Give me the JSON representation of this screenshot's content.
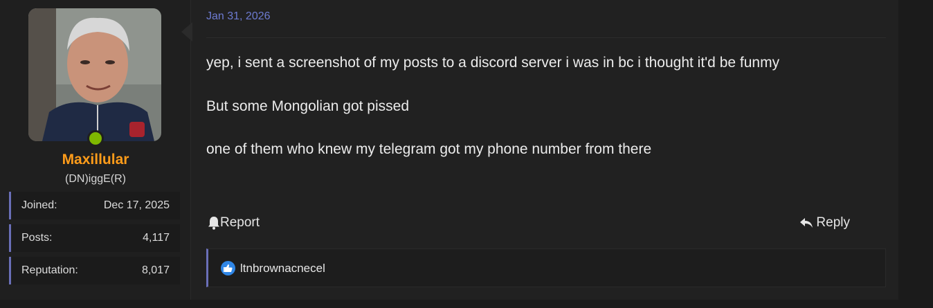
{
  "user": {
    "username": "Maxillular",
    "title": "(DN)iggE(R)",
    "online_status_color": "#7fb800",
    "username_color": "#ff9c1a",
    "stats": [
      {
        "label": "Joined:",
        "value": "Dec 17, 2025"
      },
      {
        "label": "Posts:",
        "value": "4,117"
      },
      {
        "label": "Reputation:",
        "value": "8,017"
      }
    ]
  },
  "post": {
    "date": "Jan 31, 2026",
    "paragraphs": [
      "yep, i sent a screenshot of my posts to a discord server i was in bc i thought it'd be funmy",
      "But some Mongolian got pissed",
      "one of them who knew my telegram got my phone number from there"
    ]
  },
  "actions": {
    "report_label": "Report",
    "report_icon": "bell-icon",
    "reply_label": "Reply",
    "reply_icon": "reply-arrow-icon"
  },
  "reactions": {
    "icon": "like-icon",
    "users": "ltnbrownacnecel"
  },
  "colors": {
    "accent_border": "#6a6fb8",
    "date_link": "#6d7bd1",
    "like_blue": "#2f86e6"
  }
}
